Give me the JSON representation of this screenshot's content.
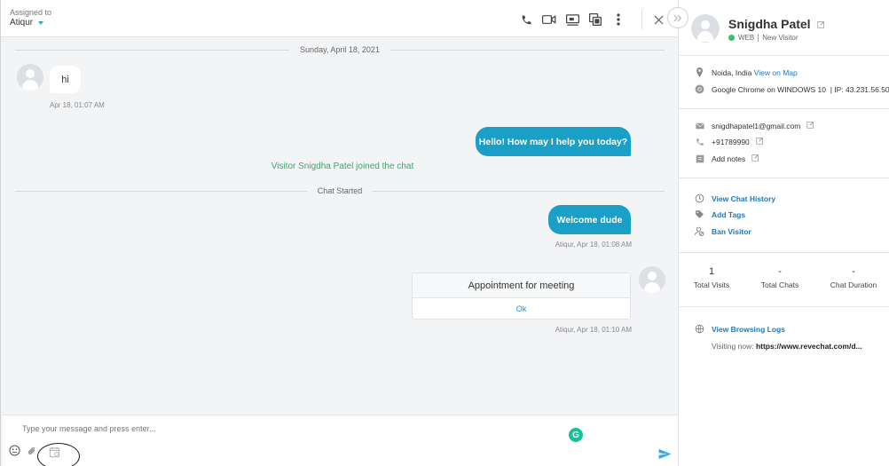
{
  "header": {
    "assigned_label": "Assigned to",
    "assigned_value": "Atiqur",
    "icons": [
      "phone-icon",
      "video-icon",
      "screen-share-icon",
      "copy-icon",
      "more-icon",
      "close-icon"
    ]
  },
  "thread": {
    "day_separator": "Sunday, April 18, 2021",
    "messages": [
      {
        "from": "visitor",
        "text": "hi",
        "time": "Apr 18, 01:07 AM"
      },
      {
        "from": "agent",
        "text": "Hello! How may I help you today?"
      },
      {
        "system": "Visitor Snigdha Patel joined the chat"
      },
      {
        "separator": "Chat Started"
      },
      {
        "from": "agent",
        "text": "Welcome dude",
        "meta": "Atiqur, Apr 18, 01:08 AM"
      },
      {
        "card_title": "Appointment for meeting",
        "card_button": "Ok",
        "meta": "Atiqur, Apr 18, 01:10 AM"
      }
    ]
  },
  "composer": {
    "placeholder": "Type your message and press enter..."
  },
  "visitor": {
    "name": "Snigdha Patel",
    "channel": "WEB",
    "status": "New Visitor",
    "location": "Noida, India",
    "map_link": "View on Map",
    "browser": "Google Chrome on WINDOWS 10",
    "ip": "| IP: 43.231.56.50",
    "email": "snigdhapatel1@gmail.com",
    "phone": "+91789990",
    "notes": "Add notes",
    "actions": [
      "View Chat History",
      "Add Tags",
      "Ban Visitor"
    ],
    "stats": [
      {
        "value": "1",
        "label": "Total Visits"
      },
      {
        "value": "-",
        "label": "Total Chats"
      },
      {
        "value": "-",
        "label": "Chat Duration"
      }
    ],
    "browsing_logs": "View Browsing Logs",
    "visiting_label": "Visiting now:",
    "visiting_url": "https://www.revechat.com/d..."
  },
  "colors": {
    "accent": "#1a9fc7",
    "link": "#1f78b8",
    "online": "#3ac06a",
    "system_text": "#3aa86a"
  }
}
